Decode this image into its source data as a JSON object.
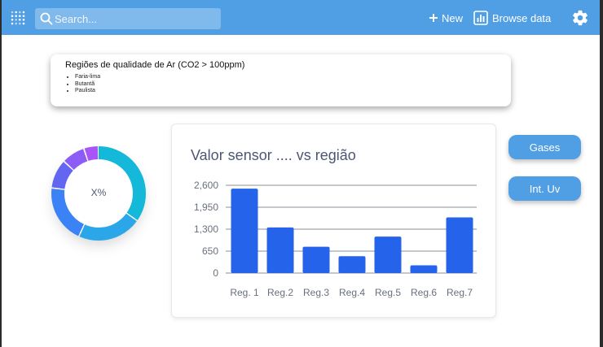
{
  "header": {
    "logo_icon": "metabase-logo-icon",
    "search_placeholder": "Search...",
    "new_label": "New",
    "browse_label": "Browse data",
    "settings_icon": "gear-icon",
    "bar_color": "#509ee3"
  },
  "card": {
    "title": "Regiões de qualidade de Ar (CO2 > 100ppm)",
    "items": [
      "Faria-lima",
      "Butantã",
      "Paulista"
    ]
  },
  "donut": {
    "label": "X%",
    "segments": [
      {
        "fraction": 0.35,
        "color": "#14b8d9"
      },
      {
        "fraction": 0.22,
        "color": "#2aa6e9"
      },
      {
        "fraction": 0.2,
        "color": "#3b82f6"
      },
      {
        "fraction": 0.1,
        "color": "#6366f1"
      },
      {
        "fraction": 0.08,
        "color": "#8b5cf6"
      },
      {
        "fraction": 0.05,
        "color": "#a855f7"
      }
    ]
  },
  "chart_data": {
    "type": "bar",
    "title": "Valor sensor ....  vs região",
    "categories": [
      "Reg. 1",
      "Reg.2",
      "Reg.3",
      "Reg.4",
      "Reg.5",
      "Reg.6",
      "Reg.7"
    ],
    "values": [
      2500,
      1350,
      780,
      500,
      1080,
      230,
      1650
    ],
    "yticks": [
      "2,600",
      "1,950",
      "1,300",
      "650",
      "0"
    ],
    "ylim": [
      0,
      2600
    ],
    "grid": true,
    "color": "#2563eb"
  },
  "buttons": {
    "gases": "Gases",
    "uv": "Int. Uv"
  }
}
